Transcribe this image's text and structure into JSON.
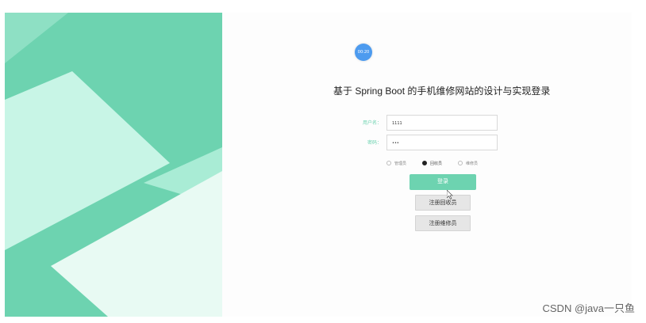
{
  "timer": {
    "text": "00:20"
  },
  "title": "基于 Spring Boot 的手机维修网站的设计与实现登录",
  "form": {
    "username_label": "用户名：",
    "username_value": "1111",
    "password_label": "密码：",
    "password_value": "•••"
  },
  "roles": {
    "selected": "回收员",
    "options": [
      "管理员",
      "回收员",
      "维修员"
    ]
  },
  "buttons": {
    "login": "登录",
    "register_recycler": "注册回收员",
    "register_repairer": "注册维修员"
  },
  "colors": {
    "accent": "#6dd3b0",
    "panel_light": "#c8f5e6"
  },
  "watermark": "CSDN @java一只鱼"
}
